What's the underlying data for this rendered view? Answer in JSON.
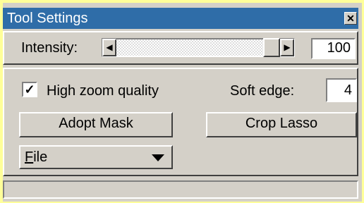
{
  "window": {
    "title": "Tool Settings"
  },
  "intensity": {
    "label": "Intensity:",
    "value": "100",
    "slider_fraction": 0.94
  },
  "options": {
    "high_zoom_label": "High zoom quality",
    "high_zoom_checked": true,
    "soft_edge_label": "Soft edge:",
    "soft_edge_value": "4"
  },
  "buttons": {
    "adopt_mask": "Adopt Mask",
    "crop_lasso": "Crop Lasso"
  },
  "file_menu": {
    "accel": "F",
    "rest": "ile"
  },
  "status": {
    "text": ""
  },
  "icons": {
    "close": "close-icon",
    "left": "arrow-left-icon",
    "right": "arrow-right-icon",
    "check": "checkmark-icon",
    "dropdown": "chevron-down-icon"
  },
  "colors": {
    "titlebar": "#2f6da8",
    "face": "#d4d0c8",
    "outer": "#ffff99"
  }
}
